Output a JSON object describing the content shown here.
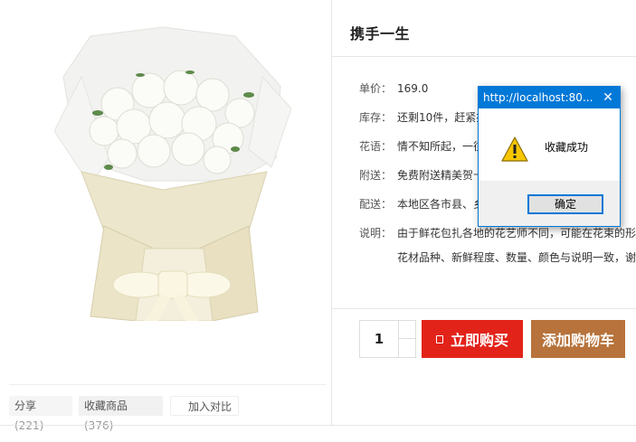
{
  "product": {
    "title": "携手一生",
    "price_label": "单价：",
    "price": "169.0",
    "stock_label": "库存：",
    "stock": "还剩10件，赶紧抢",
    "flower_language_label": "花语：",
    "flower_language": "情不知所起，一往",
    "gift_label": "附送：",
    "gift": "免费附送精美贺卡",
    "delivery_label": "配送：",
    "delivery": "本地区各市县、乡",
    "description_label": "说明：",
    "description_line1": "由于鲜花包扎各地的花艺师不同，可能在花束的形",
    "description_line2": "花材品种、新鲜程度、数量、颜色与说明一致，谢"
  },
  "actions": {
    "share_label": "分享",
    "share_count": "(221)",
    "favorite_label": "收藏商品",
    "favorite_count": "(376)",
    "compare_label": "加入对比",
    "quantity": "1",
    "buy_now_label": "立即购买",
    "add_to_cart_label": "添加购物车"
  },
  "dialog": {
    "title": "http://localhost:80...",
    "message": "收藏成功",
    "ok_label": "确定",
    "icon": "warning-icon"
  },
  "colors": {
    "buy_button": "#e2231a",
    "cart_button": "#b7733b",
    "dialog_accent": "#0078d7"
  }
}
